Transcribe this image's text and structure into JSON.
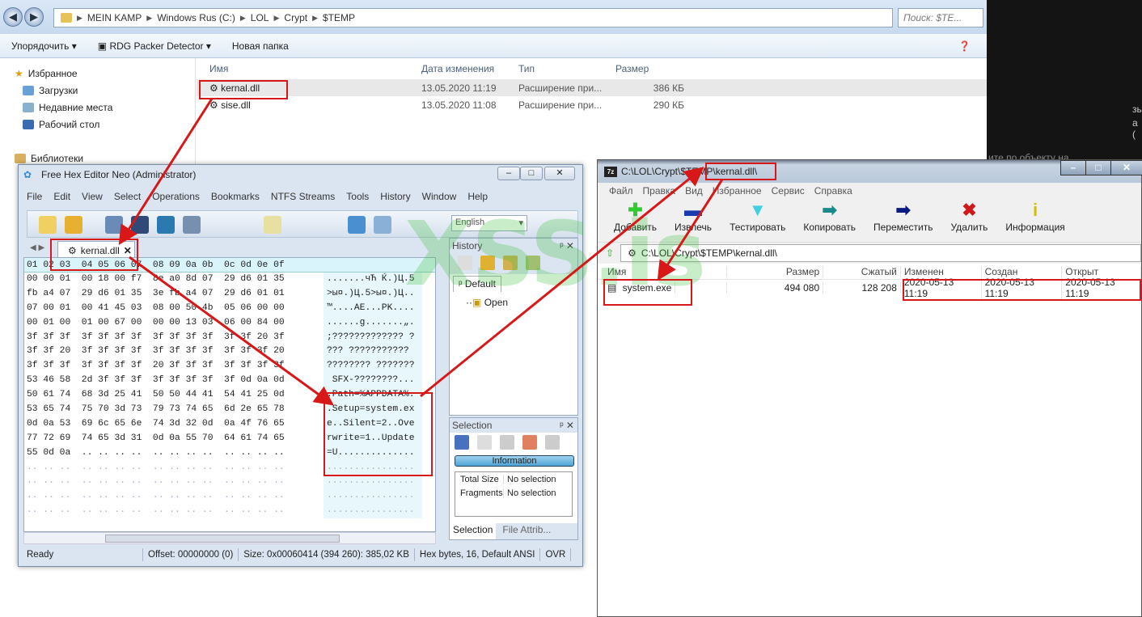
{
  "desktop": {
    "fragments": [
      "зы",
      "а (",
      "ите по объекту на"
    ]
  },
  "explorer": {
    "breadcrumb": [
      "MEIN KAMP",
      "Windows Rus (C:)",
      "LOL",
      "Crypt",
      "$TEMP"
    ],
    "search_placeholder": "Поиск: $TE...",
    "toolbar": {
      "organize": "Упорядочить",
      "packer": "RDG Packer Detector",
      "new_folder": "Новая папка"
    },
    "nav": {
      "favorites": "Избранное",
      "items": [
        "Загрузки",
        "Недавние места",
        "Рабочий стол"
      ],
      "libraries": "Библиотеки"
    },
    "columns": [
      "Имя",
      "Дата изменения",
      "Тип",
      "Размер"
    ],
    "files": [
      {
        "name": "kernal.dll",
        "date": "13.05.2020 11:19",
        "type": "Расширение при...",
        "size": "386 КБ"
      },
      {
        "name": "sise.dll",
        "date": "13.05.2020 11:08",
        "type": "Расширение при...",
        "size": "290 КБ"
      }
    ]
  },
  "hex": {
    "title": "Free Hex Editor Neo (Administrator)",
    "menu": [
      "File",
      "Edit",
      "View",
      "Select",
      "Operations",
      "Bookmarks",
      "NTFS Streams",
      "Tools",
      "History",
      "Window",
      "Help"
    ],
    "language": "English",
    "tab": "kernal.dll",
    "header": "01 02 03  04 05 06 07  08 09 0a 0b  0c 0d 0e 0f",
    "rows": [
      {
        "hex": "00 00 01  00 18 00 f7  8e a0 8d 07  29 d6 01 35",
        "ascii": ".......чЋ Ќ.)Ц.5"
      },
      {
        "hex": "fb a4 07  29 d6 01 35  3e fb a4 07  29 d6 01 01",
        "ascii": ">ы¤.)Ц.5>ы¤.)Ц.."
      },
      {
        "hex": "07 00 01  00 41 45 03  08 00 50 4b  05 06 00 00",
        "ascii": "™....AE...PK...."
      },
      {
        "hex": "00 01 00  01 00 67 00  00 00 13 03  06 00 84 00",
        "ascii": "......g.......„."
      },
      {
        "hex": "3f 3f 3f  3f 3f 3f 3f  3f 3f 3f 3f  3f 3f 20 3f",
        "ascii": ";????????????? ?"
      },
      {
        "hex": "3f 3f 20  3f 3f 3f 3f  3f 3f 3f 3f  3f 3f 3f 20",
        "ascii": "??? ???????????"
      },
      {
        "hex": "3f 3f 3f  3f 3f 3f 3f  20 3f 3f 3f  3f 3f 3f 3f",
        "ascii": "???????? ???????"
      },
      {
        "hex": "53 46 58  2d 3f 3f 3f  3f 3f 3f 3f  3f 0d 0a 0d",
        "ascii": " SFX-????????..."
      },
      {
        "hex": "50 61 74  68 3d 25 41  50 50 44 41  54 41 25 0d",
        "ascii": ".Path=%APPDATA%."
      },
      {
        "hex": "53 65 74  75 70 3d 73  79 73 74 65  6d 2e 65 78",
        "ascii": ".Setup=system.ex"
      },
      {
        "hex": "0d 0a 53  69 6c 65 6e  74 3d 32 0d  0a 4f 76 65",
        "ascii": "e..Silent=2..Ove"
      },
      {
        "hex": "77 72 69  74 65 3d 31  0d 0a 55 70  64 61 74 65",
        "ascii": "rwrite=1..Update"
      },
      {
        "hex": "55 0d 0a  .. .. .. ..  .. .. .. ..  .. .. .. ..",
        "ascii": "=U.............."
      }
    ],
    "history": {
      "title": "History",
      "tab": "Default",
      "item": "Open"
    },
    "selection": {
      "title": "Selection",
      "info": "Information",
      "rows": [
        [
          "Total Size",
          "No selection"
        ],
        [
          "Fragments",
          "No selection"
        ]
      ],
      "tabs": [
        "Selection",
        "File Attrib..."
      ]
    },
    "status": [
      "Ready",
      "Offset: 00000000 (0)",
      "Size: 0x00060414 (394 260): 385,02 KB",
      "Hex bytes, 16, Default ANSI",
      "OVR"
    ]
  },
  "zip": {
    "title": "C:\\LOL\\Crypt\\$TEMP\\kernal.dll\\",
    "menu": [
      "Файл",
      "Правка",
      "Вид",
      "Избранное",
      "Сервис",
      "Справка"
    ],
    "tools": [
      {
        "label": "Добавить",
        "glyph": "✚",
        "color": "#2ecc2e"
      },
      {
        "label": "Извлечь",
        "glyph": "▬",
        "color": "#1a3bb0"
      },
      {
        "label": "Тестировать",
        "glyph": "▼",
        "color": "#40d0e0"
      },
      {
        "label": "Копировать",
        "glyph": "➡",
        "color": "#1a8a8a"
      },
      {
        "label": "Переместить",
        "glyph": "➡",
        "color": "#0a1a80"
      },
      {
        "label": "Удалить",
        "glyph": "✖",
        "color": "#d01818"
      },
      {
        "label": "Информация",
        "glyph": "i",
        "color": "#d0c000"
      }
    ],
    "path": "C:\\LOL\\Crypt\\$TEMP\\kernal.dll\\",
    "columns": [
      "Имя",
      "Размер",
      "Сжатый",
      "Изменен",
      "Создан",
      "Открыт"
    ],
    "rows": [
      {
        "name": "system.exe",
        "size": "494 080",
        "packed": "128 208",
        "modified": "2020-05-13 11:19",
        "created": "2020-05-13 11:19",
        "accessed": "2020-05-13 11:19"
      }
    ]
  },
  "watermark": "XSS.is"
}
